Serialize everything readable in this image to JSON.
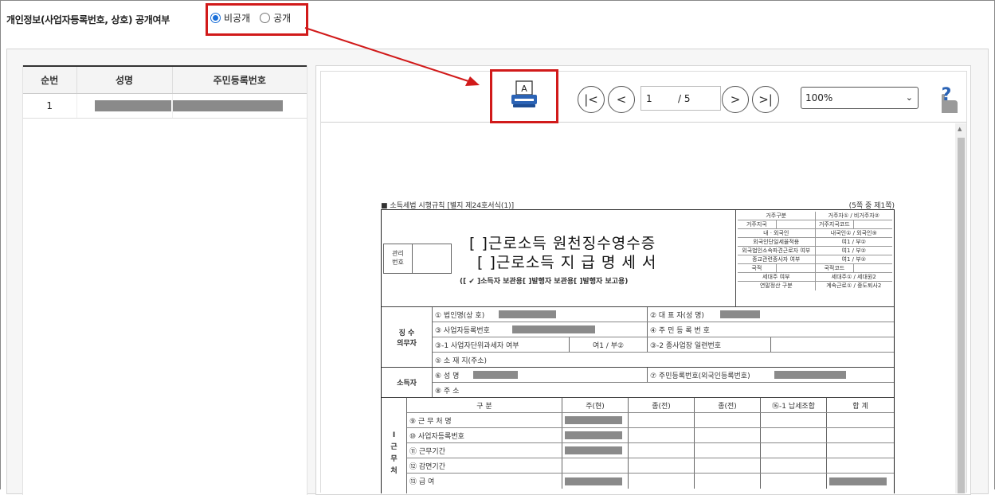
{
  "privacy": {
    "label": "개인정보(사업자등록번호, 상호) 공개여부",
    "options": [
      {
        "label": "비공개",
        "checked": true
      },
      {
        "label": "공개",
        "checked": false
      }
    ]
  },
  "employee_table": {
    "columns": [
      "순번",
      "성명",
      "주민등록번호"
    ],
    "rows": [
      {
        "index": "1"
      }
    ]
  },
  "viewer": {
    "page_current": "1",
    "page_total": "/ 5",
    "zoom": "100%",
    "zoom_caret": "⌄",
    "help_label": "?"
  },
  "document": {
    "rule_ref": "■ 소득세법 시행규칙 [별지 제24호서식(1)]",
    "page_ref": "(5쪽 중 제1쪽)",
    "mgmt_label": "관리\n번호",
    "title_line1": "[  ]근로소득 원천징수영수증",
    "title_line2": "[  ]근로소득 지 급 명 세 서",
    "copy_line": "([ ✔ ]소득자 보관용[      ]발행자 보관용[      ]발행자 보고용)",
    "side_table": [
      [
        "거주구분",
        "거주자① / 비거주자②"
      ],
      [
        "거주지국",
        "",
        "거주지국코드",
        ""
      ],
      [
        "내ㆍ외국인",
        "내국인① / 외국인⑨"
      ],
      [
        "외국인단일세율적용",
        "여1 / 부②"
      ],
      [
        "외국법인소속파견근로자 여부",
        "여1 / 부②"
      ],
      [
        "종교관련종사자 여부",
        "여1 / 부②"
      ],
      [
        "국적",
        "",
        "국적코드",
        ""
      ],
      [
        "세대주 여부",
        "세대주① / 세대원2"
      ],
      [
        "연말정산 구분",
        "계속근로① / 중도퇴사2"
      ]
    ],
    "payer_label": "징 수\n의무자",
    "payer_rows": {
      "company": "① 법인명(상 호)",
      "ceo": "② 대 표 자(성   명)",
      "bizno": "③ 사업자등록번호",
      "resno": "④ 주 민 등 록 번 호",
      "unit_tax": "③-1 사업자단위과세자 여부",
      "unit_tax_val": "여1 / 부②",
      "branch_no": "③-2 종사업장 일련번호",
      "address": "⑤ 소 재 지(주소)"
    },
    "earner_label": "소득자",
    "earner_rows": {
      "name": "⑥ 성        명",
      "resno": "⑦ 주민등록번호(외국인등록번호)",
      "address": "⑧ 주          소"
    },
    "work_label": "Ⅰ\n근\n무\n처",
    "work_header": [
      "구   분",
      "주(현)",
      "종(전)",
      "종(전)",
      "⑯-1 납세조합",
      "합   계"
    ],
    "work_rows": [
      "⑨ 근 무 처 명",
      "⑩ 사업자등록번호",
      "⑪ 근무기간",
      "⑫ 감면기간",
      "⑬ 급           여"
    ]
  }
}
